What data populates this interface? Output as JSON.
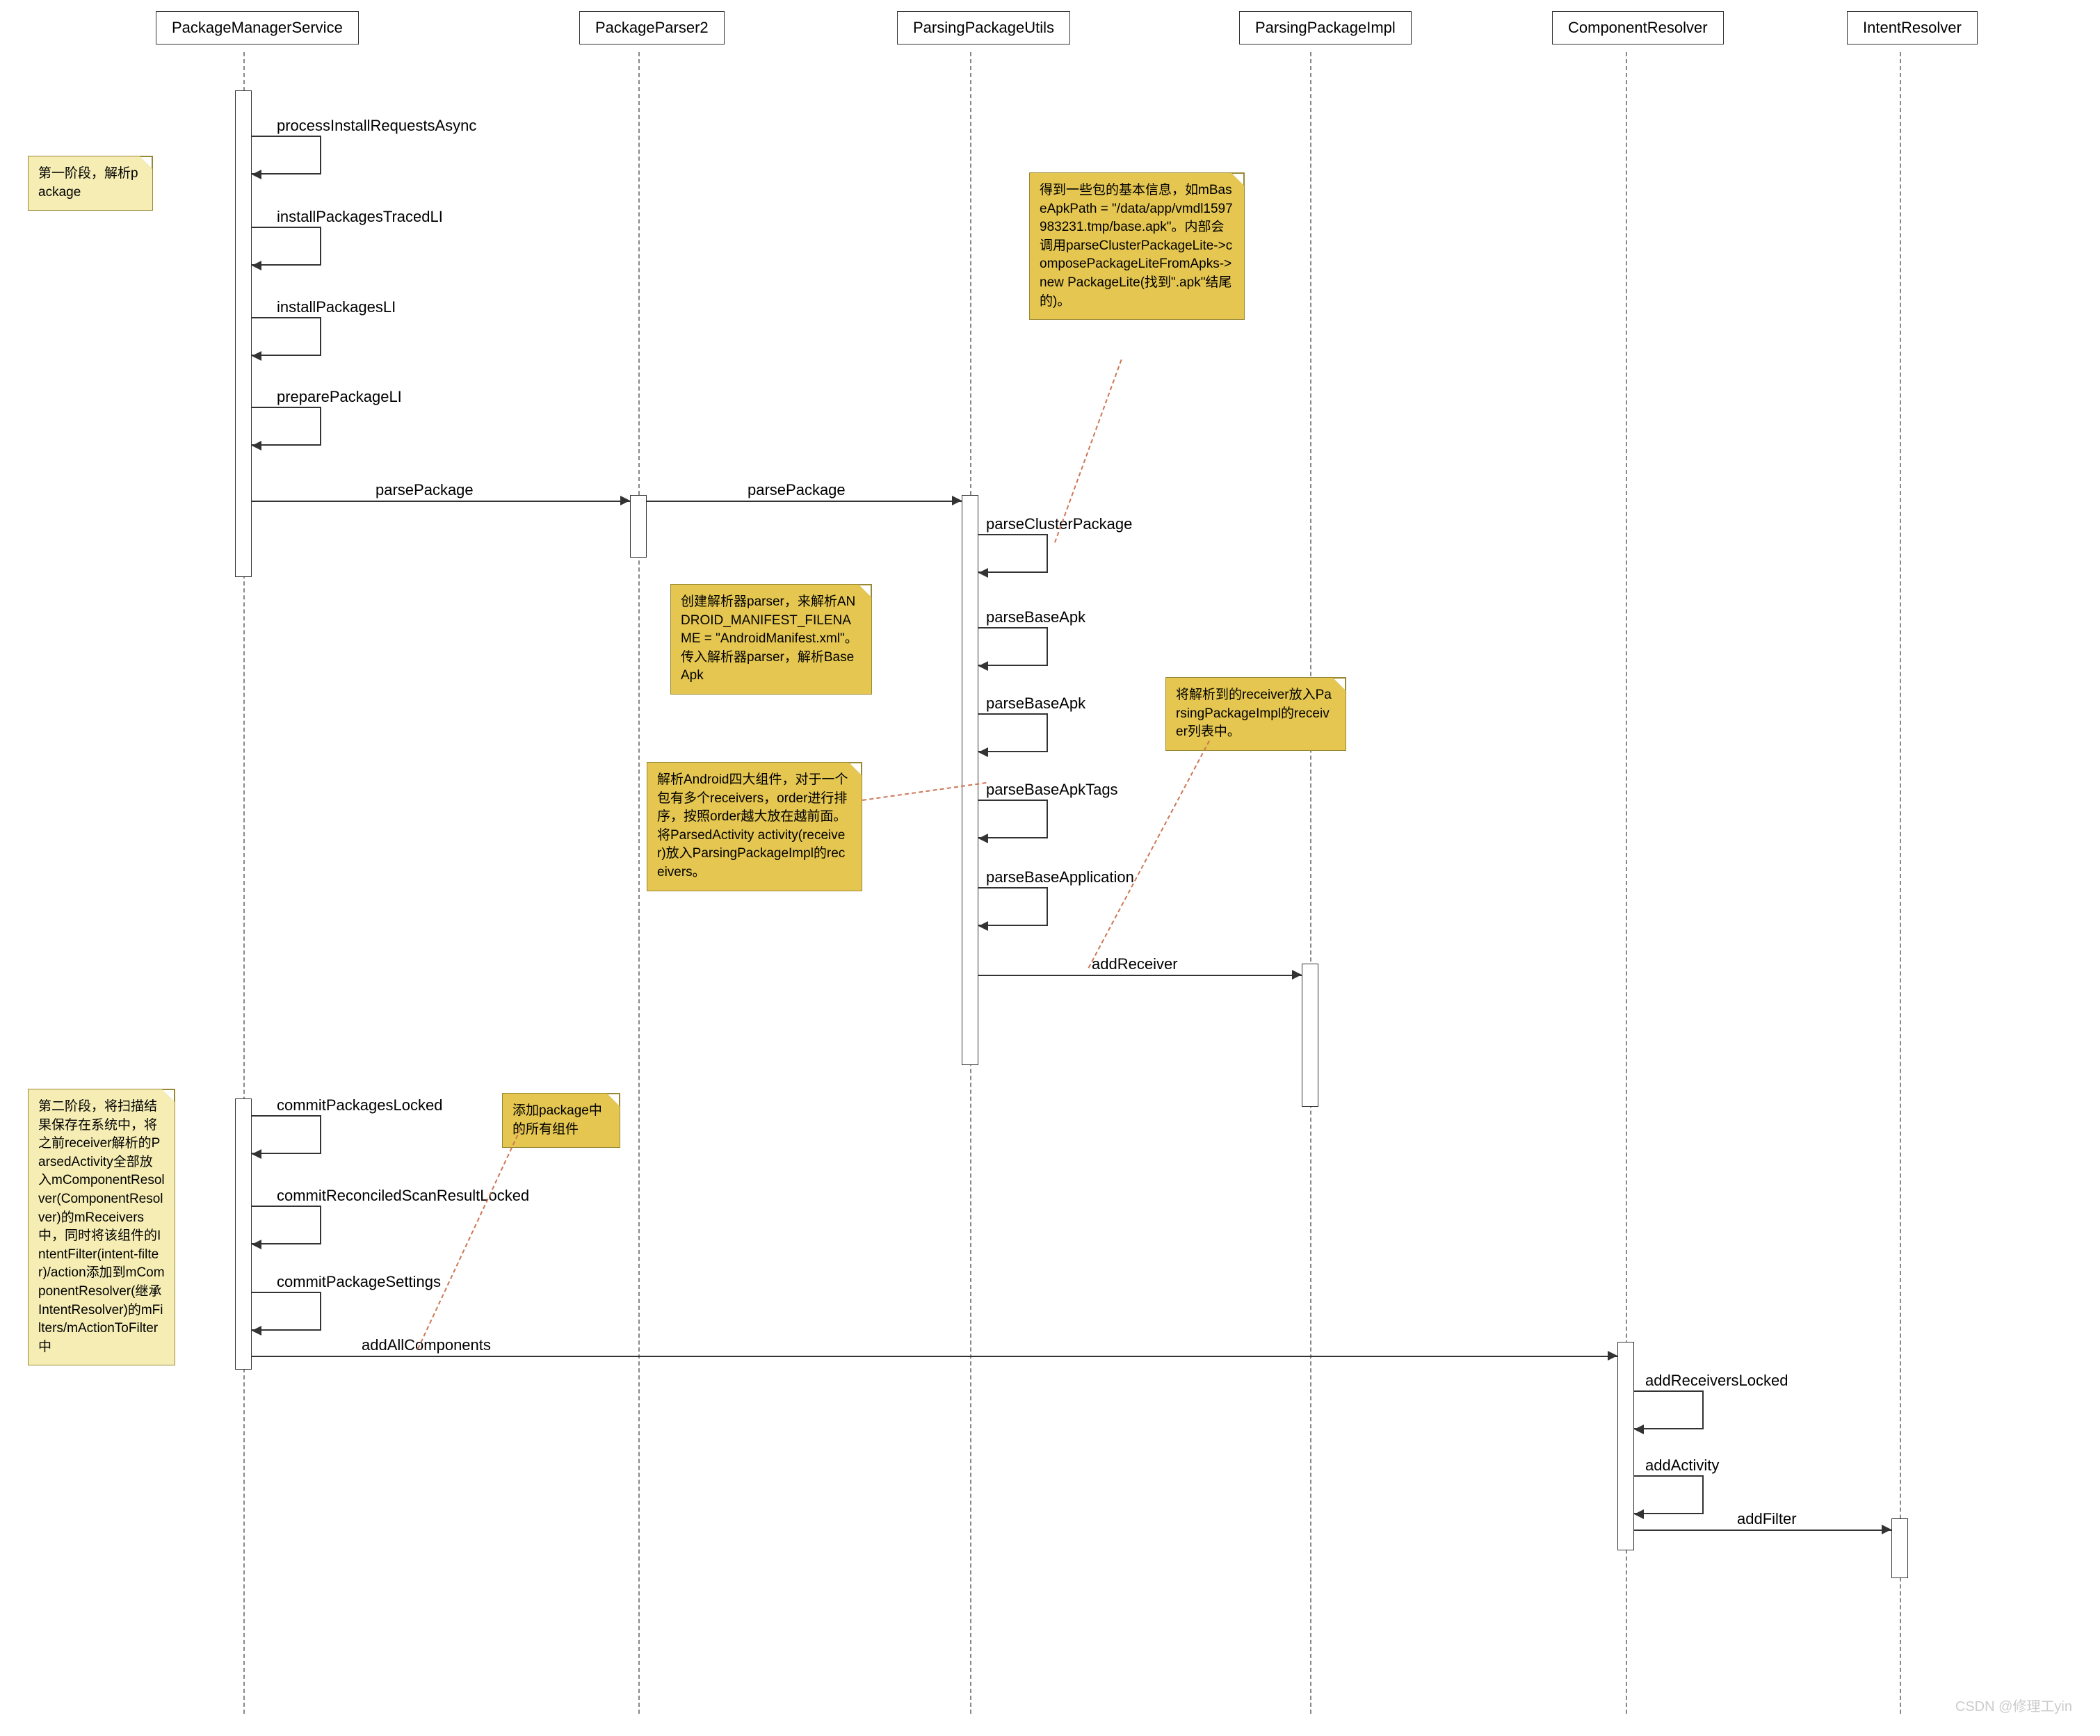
{
  "participants": {
    "pms": "PackageManagerService",
    "pp2": "PackageParser2",
    "ppu": "ParsingPackageUtils",
    "ppi": "ParsingPackageImpl",
    "cr": "ComponentResolver",
    "ir": "IntentResolver"
  },
  "messages": {
    "processInstallRequestsAsync": "processInstallRequestsAsync",
    "installPackagesTracedLI": "installPackagesTracedLI",
    "installPackagesLI": "installPackagesLI",
    "preparePackageLI": "preparePackageLI",
    "parsePackage1": "parsePackage",
    "parsePackage2": "parsePackage",
    "parseClusterPackage": "parseClusterPackage",
    "parseBaseApk1": "parseBaseApk",
    "parseBaseApk2": "parseBaseApk",
    "parseBaseApkTags": "parseBaseApkTags",
    "parseBaseApplication": "parseBaseApplication",
    "addReceiver": "addReceiver",
    "commitPackagesLocked": "commitPackagesLocked",
    "commitReconciledScanResultLocked": "commitReconciledScanResultLocked",
    "commitPackageSettings": "commitPackageSettings",
    "addAllComponents": "addAllComponents",
    "addReceiversLocked": "addReceiversLocked",
    "addActivity": "addActivity",
    "addFilter": "addFilter"
  },
  "notes": {
    "phase1": "第一阶段，解析package",
    "baseApkInfo": "得到一些包的基本信息，如mBaseApkPath = \"/data/app/vmdl1597983231.tmp/base.apk\"。内部会调用parseClusterPackageLite->composePackageLiteFromApks->new PackageLite(找到\".apk\"结尾的)。",
    "createParser": "创建解析器parser，来解析ANDROID_MANIFEST_FILENAME = \"AndroidManifest.xml\"。\n传入解析器parser，解析BaseApk",
    "putReceiver": "将解析到的receiver放入ParsingPackageImpl的receiver列表中。",
    "fourComponents": "解析Android四大组件，对于一个包有多个receivers，order进行排序，按照order越大放在越前面。\n将ParsedActivity activity(receiver)放入ParsingPackageImpl的receivers。",
    "phase2": "第二阶段，将扫描结果保存在系统中，将之前receiver解析的ParsedActivity全部放入mComponentResolver(ComponentResolver)的mReceivers中，同时将该组件的IntentFilter(intent-filter)/action添加到mComponentResolver(继承IntentResolver)的mFilters/mActionToFilter中",
    "addAllComp": "添加package中的所有组件"
  },
  "watermark": "CSDN @修理工yin"
}
